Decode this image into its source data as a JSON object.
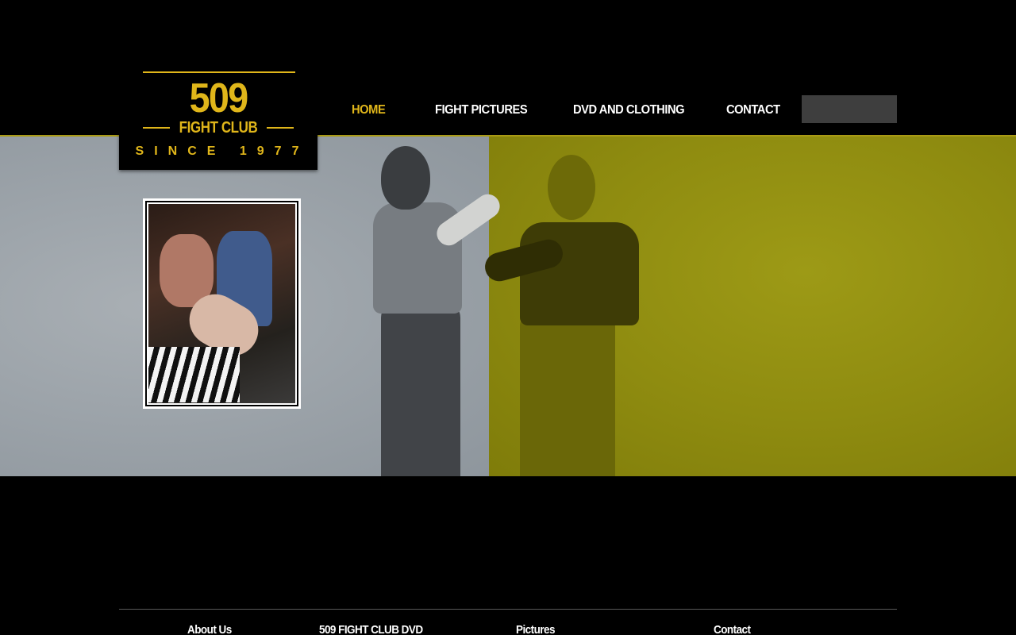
{
  "logo": {
    "number": "509",
    "name": "FIGHT CLUB",
    "since": "SINCE 1977"
  },
  "nav": {
    "items": [
      {
        "label": "HOME",
        "active": true
      },
      {
        "label": "FIGHT PICTURES",
        "active": false
      },
      {
        "label": "DVD AND CLOTHING",
        "active": false
      },
      {
        "label": "CONTACT",
        "active": false
      }
    ]
  },
  "footer": {
    "links": [
      {
        "label": "About Us"
      },
      {
        "label": "509 FIGHT CLUB DVD"
      },
      {
        "label": "Pictures"
      },
      {
        "label": "Contact"
      }
    ]
  },
  "colors": {
    "accent": "#e0b61a",
    "background": "#000000",
    "hero_left": "#9ea5ab",
    "hero_right": "#8f8c10",
    "search_box": "#3e3e3e"
  }
}
